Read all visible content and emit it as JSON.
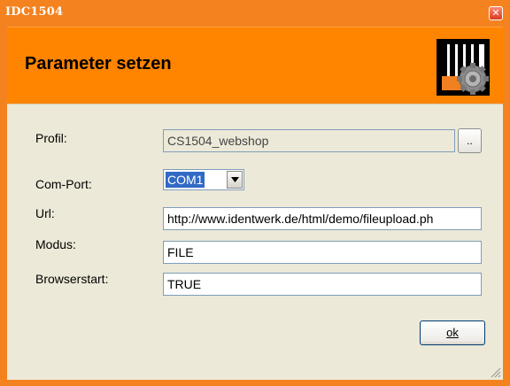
{
  "window": {
    "title": "IDC1504",
    "close_label": "✕"
  },
  "header": {
    "title": "Parameter setzen",
    "logo_icon": "piano-gear-icon"
  },
  "form": {
    "profil_label": "Profil:",
    "profil_value": "CS1504_webshop",
    "browse_label": "..",
    "comport_label": "Com-Port:",
    "comport_value": "COM1",
    "url_label": "Url:",
    "url_value": "http://www.identwerk.de/html/demo/fileupload.ph",
    "modus_label": "Modus:",
    "modus_value": "FILE",
    "browserstart_label": "Browserstart:",
    "browserstart_value": "TRUE",
    "ok_label": "ok"
  },
  "colors": {
    "accent": "#ff8400",
    "titlebar": "#f4821e",
    "panel": "#ece9d8",
    "selection": "#316ac5"
  }
}
